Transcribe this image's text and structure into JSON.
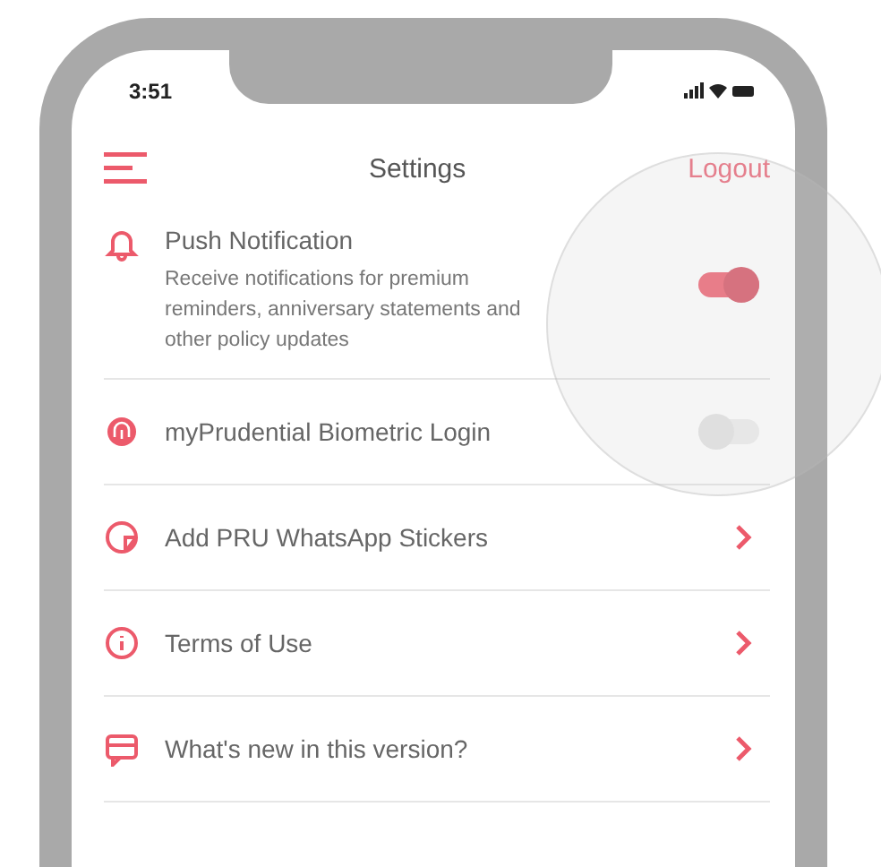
{
  "status_bar": {
    "time": "3:51"
  },
  "header": {
    "title": "Settings",
    "action": "Logout"
  },
  "settings": [
    {
      "kind": "toggle",
      "label": "Push Notification",
      "description": "Receive notifications for premium reminders, anniversary statements and other policy updates",
      "on": true
    },
    {
      "kind": "toggle",
      "label": "myPrudential Biometric Login",
      "on": false
    },
    {
      "kind": "link",
      "label": "Add PRU WhatsApp Stickers"
    },
    {
      "kind": "link",
      "label": "Terms of Use"
    },
    {
      "kind": "link",
      "label": "What's new in this version?"
    }
  ]
}
